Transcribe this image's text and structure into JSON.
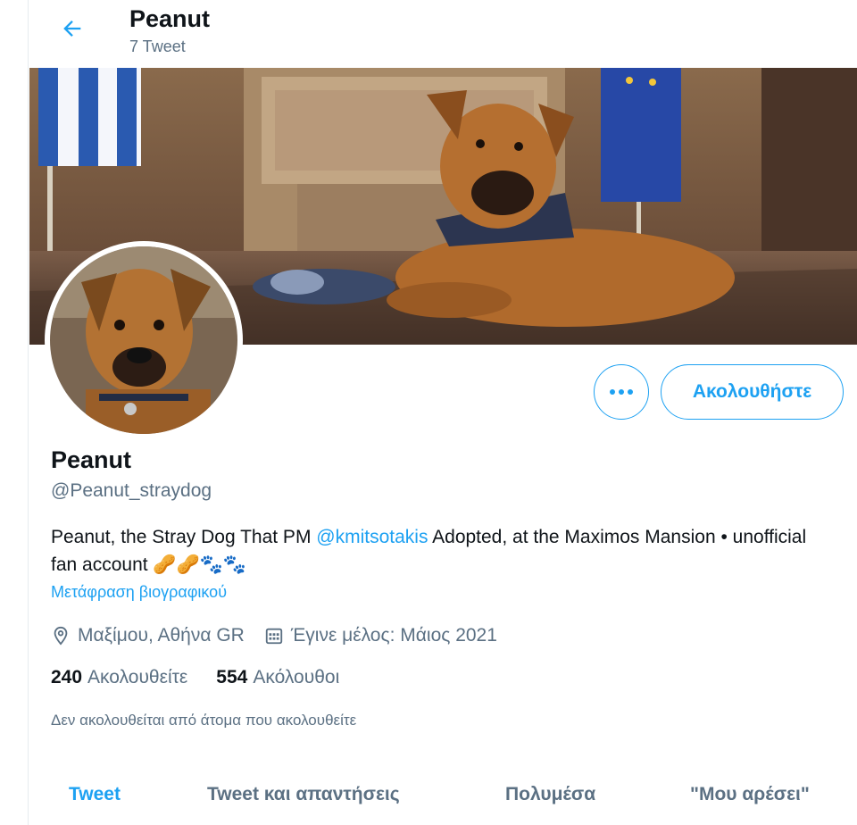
{
  "header": {
    "title": "Peanut",
    "subtitle": "7 Tweet"
  },
  "profile": {
    "name": "Peanut",
    "handle": "@Peanut_straydog",
    "bio_prefix": "Peanut, the Stray Dog That PM ",
    "bio_mention": "@kmitsotakis",
    "bio_suffix": " Adopted, at the Maximos Mansion • unofficial fan account ",
    "bio_emoji": "🥜🥜🐾🐾",
    "translate_label": "Μετάφραση βιογραφικού",
    "location": "Μαξίμου, Αθήνα GR",
    "joined": "Έγινε μέλος: Μάιος 2021",
    "following_count": "240",
    "following_label": "Ακολουθείτε",
    "followers_count": "554",
    "followers_label": "Ακόλουθοι",
    "not_followed_text": "Δεν ακολουθείται από άτομα που ακολουθείτε"
  },
  "actions": {
    "follow_label": "Ακολουθήστε",
    "more_icon": "more-horizontal-icon"
  },
  "tabs": [
    {
      "label": "Tweet",
      "active": true
    },
    {
      "label": "Tweet και απαντήσεις",
      "active": false
    },
    {
      "label": "Πολυμέσα",
      "active": false
    },
    {
      "label": "\"Μου αρέσει\"",
      "active": false
    }
  ],
  "colors": {
    "accent": "#1da1f2",
    "text_primary": "#0f1419",
    "text_secondary": "#5b7083"
  }
}
